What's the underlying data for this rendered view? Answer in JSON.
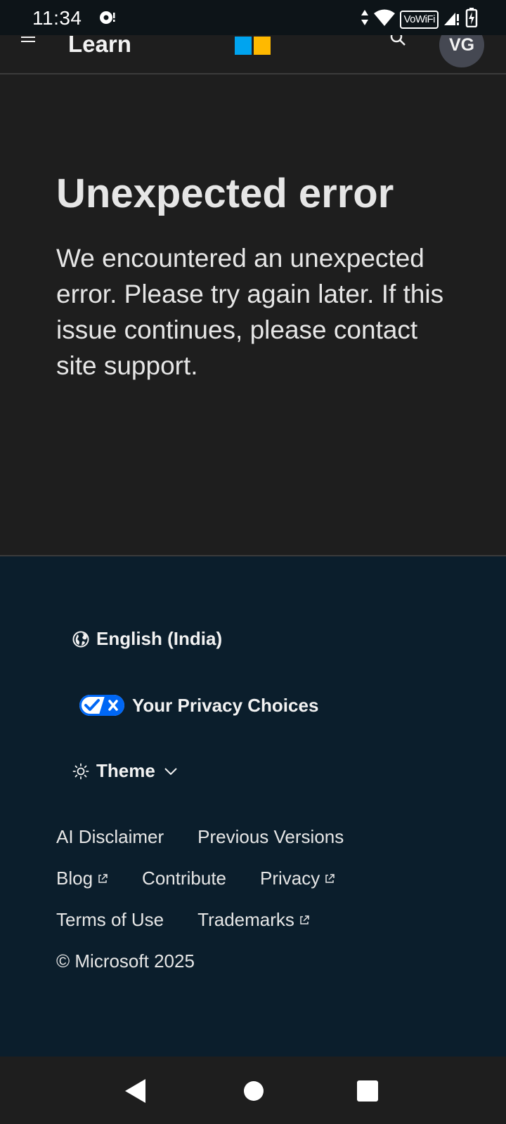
{
  "status_bar": {
    "time": "11:34",
    "vowifi": "VoWiFi"
  },
  "header": {
    "title": "Learn",
    "avatar_initials": "VG",
    "logo_colors": [
      "#00a4ef",
      "#ffb900"
    ]
  },
  "error": {
    "title": "Unexpected error",
    "message": "We encountered an unexpected error. Please try again later. If this issue continues, please contact site support."
  },
  "footer": {
    "language": "English (India)",
    "privacy_choices": "Your Privacy Choices",
    "theme": "Theme",
    "links": {
      "ai_disclaimer": "AI Disclaimer",
      "previous_versions": "Previous Versions",
      "blog": "Blog",
      "contribute": "Contribute",
      "privacy": "Privacy",
      "terms": "Terms of Use",
      "trademarks": "Trademarks"
    },
    "copyright": "© Microsoft 2025"
  },
  "icons": {
    "notification": "notification-icon",
    "data_arrows": "data-arrows-icon",
    "wifi": "wifi-icon",
    "signal": "signal-icon",
    "battery": "battery-charging-icon",
    "menu": "menu-icon",
    "search": "search-icon",
    "globe": "globe-icon",
    "privacy_toggle": "privacy-toggle-icon",
    "theme": "sun-icon",
    "chevron": "chevron-down-icon",
    "external": "external-link-icon"
  },
  "colors": {
    "page_bg": "#1e1e1e",
    "footer_bg": "#0b1e2c",
    "privacy_blue": "#0067f5"
  }
}
